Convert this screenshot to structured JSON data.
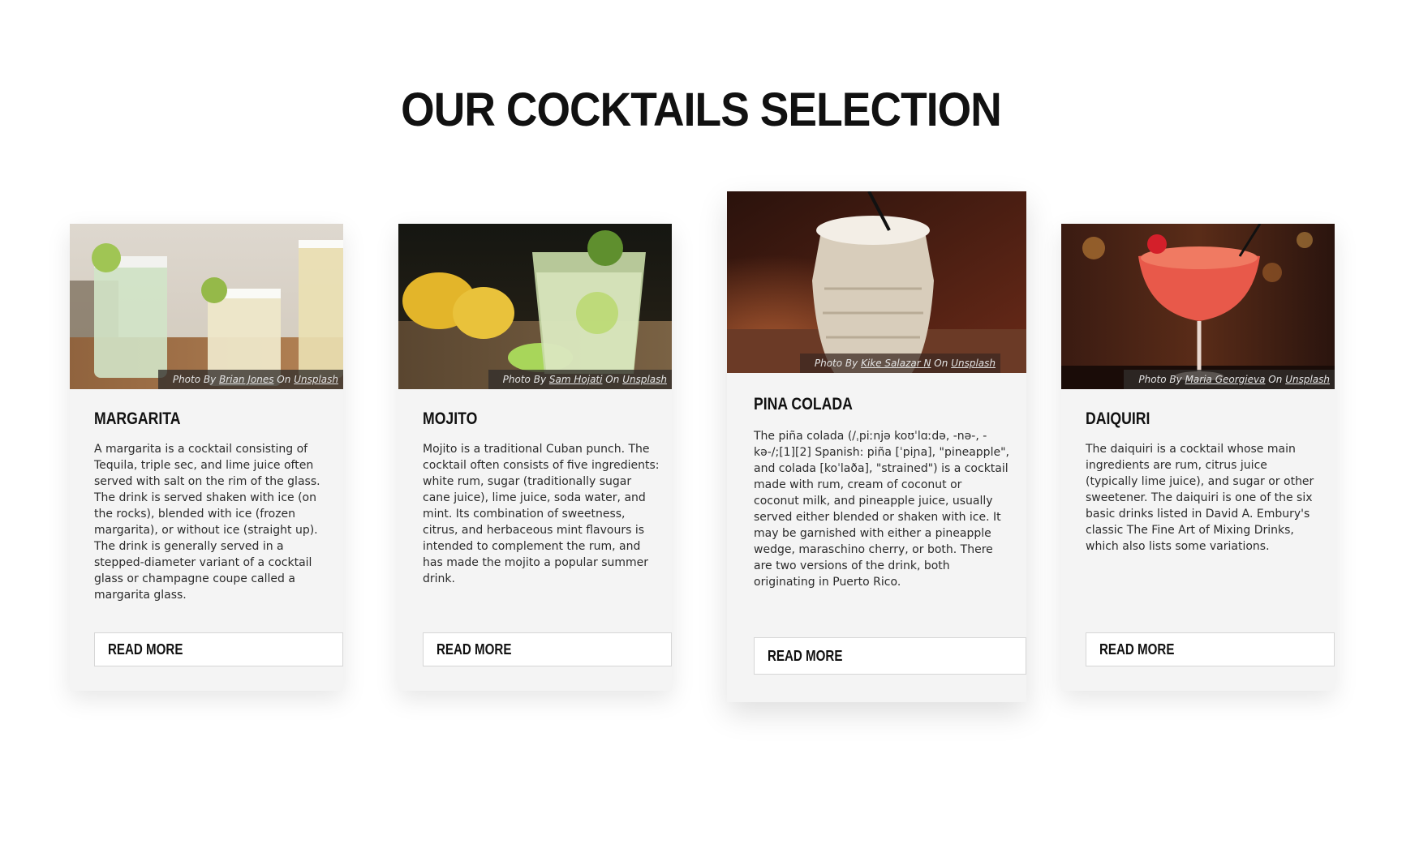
{
  "page": {
    "title": "OUR COCKTAILS SELECTION"
  },
  "cards": [
    {
      "name": "MARGARITA",
      "description": "A margarita is a cocktail consisting of Tequila, triple sec, and lime juice often served with salt on the rim of the glass. The drink is served shaken with ice (on the rocks), blended with ice (frozen margarita), or without ice (straight up). The drink is generally served in a stepped-diameter variant of a cocktail glass or champagne coupe called a margarita glass.",
      "credit": {
        "prefix": "Photo By",
        "author": "Brian Jones",
        "on": "On",
        "site": "Unsplash"
      },
      "button": "READ MORE",
      "image_icon": "margarita-glasses-photo"
    },
    {
      "name": "MOJITO",
      "description": "Mojito is a traditional Cuban punch. The cocktail often consists of five ingredients: white rum, sugar (traditionally sugar cane juice), lime juice, soda water, and mint. Its combination of sweetness, citrus, and herbaceous mint flavours is intended to complement the rum, and has made the mojito a popular summer drink.",
      "credit": {
        "prefix": "Photo By",
        "author": "Sam Hojati",
        "on": "On",
        "site": "Unsplash"
      },
      "button": "READ MORE",
      "image_icon": "mojito-glass-photo"
    },
    {
      "name": "PINA COLADA",
      "description": "The piña colada (/ˌpiːnjə koʊˈlɑːdə, -nə-, -kə-/;[1][2] Spanish: piña [ˈpiɲa], \"pineapple\", and colada [koˈlaða], \"strained\") is a cocktail made with rum, cream of coconut or coconut milk, and pineapple juice, usually served either blended or shaken with ice. It may be garnished with either a pineapple wedge, maraschino cherry, or both. There are two versions of the drink, both originating in Puerto Rico.",
      "credit": {
        "prefix": "Photo By",
        "author": "Kike Salazar N",
        "on": "On",
        "site": "Unsplash"
      },
      "button": "READ MORE",
      "image_icon": "pina-colada-glass-photo"
    },
    {
      "name": "DAIQUIRI",
      "description": "The daiquiri is a cocktail whose main ingredients are rum, citrus juice (typically lime juice), and sugar or other sweetener. The daiquiri is one of the six basic drinks listed in David A. Embury's classic The Fine Art of Mixing Drinks, which also lists some variations.",
      "credit": {
        "prefix": "Photo By",
        "author": "Maria Georgieva",
        "on": "On",
        "site": "Unsplash"
      },
      "button": "READ MORE",
      "image_icon": "daiquiri-glass-photo"
    }
  ]
}
